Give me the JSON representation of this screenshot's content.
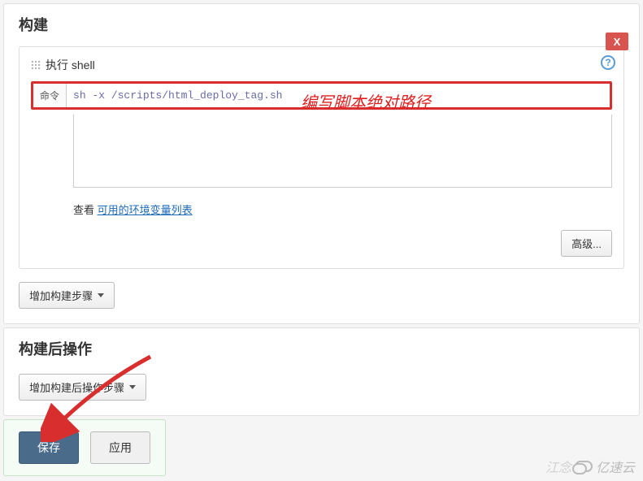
{
  "build": {
    "title": "构建",
    "shell_step": {
      "header": "执行 shell",
      "cmd_label": "命令",
      "cmd_value": "sh -x /scripts/html_deploy_tag.sh",
      "hint_prefix": "查看 ",
      "hint_link": "可用的环境变量列表",
      "advanced_btn": "高级...",
      "close_btn": "X",
      "help_icon": "?"
    },
    "add_step_btn": "增加构建步骤"
  },
  "post_build": {
    "title": "构建后操作",
    "add_step_btn": "增加构建后操作步骤"
  },
  "bottom": {
    "save": "保存",
    "apply": "应用"
  },
  "annotation": "编写脚本绝对路径",
  "watermark": "亿速云"
}
